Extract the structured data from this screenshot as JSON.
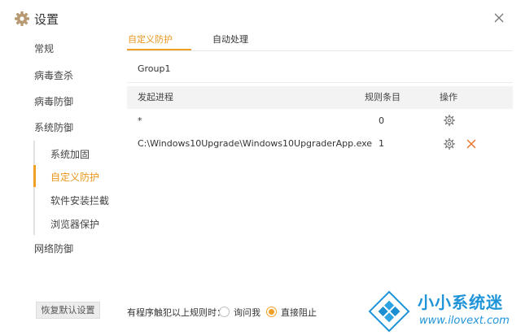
{
  "window": {
    "title": "设置"
  },
  "sidebar": {
    "items": [
      {
        "label": "常规"
      },
      {
        "label": "病毒查杀"
      },
      {
        "label": "病毒防御"
      },
      {
        "label": "系统防御"
      },
      {
        "label": "网络防御"
      }
    ],
    "subitems": [
      {
        "label": "系统加固"
      },
      {
        "label": "自定义防护",
        "active": true
      },
      {
        "label": "软件安装拦截"
      },
      {
        "label": "浏览器保护"
      }
    ],
    "restore_label": "恢复默认设置"
  },
  "tabs": [
    {
      "label": "自定义防护",
      "active": true
    },
    {
      "label": "自动处理"
    }
  ],
  "group": {
    "name": "Group1"
  },
  "table": {
    "headers": [
      "发起进程",
      "规则条目",
      "操作"
    ],
    "rows": [
      {
        "process": "*",
        "count": "0",
        "actions": [
          "gear-icon"
        ]
      },
      {
        "process": "C:\\Windows10Upgrade\\Windows10UpgraderApp.exe",
        "count": "1",
        "actions": [
          "gear-icon",
          "close-icon"
        ]
      }
    ]
  },
  "footer": {
    "label": "有程序触犯以上规则时：",
    "options": [
      {
        "label": "询问我",
        "checked": false
      },
      {
        "label": "直接阻止",
        "checked": true
      }
    ]
  },
  "watermark": {
    "title": "小小系统迷",
    "url": "www.ilovext.com"
  },
  "colors": {
    "accent": "#f0a025",
    "brand": "#1f94d8"
  }
}
